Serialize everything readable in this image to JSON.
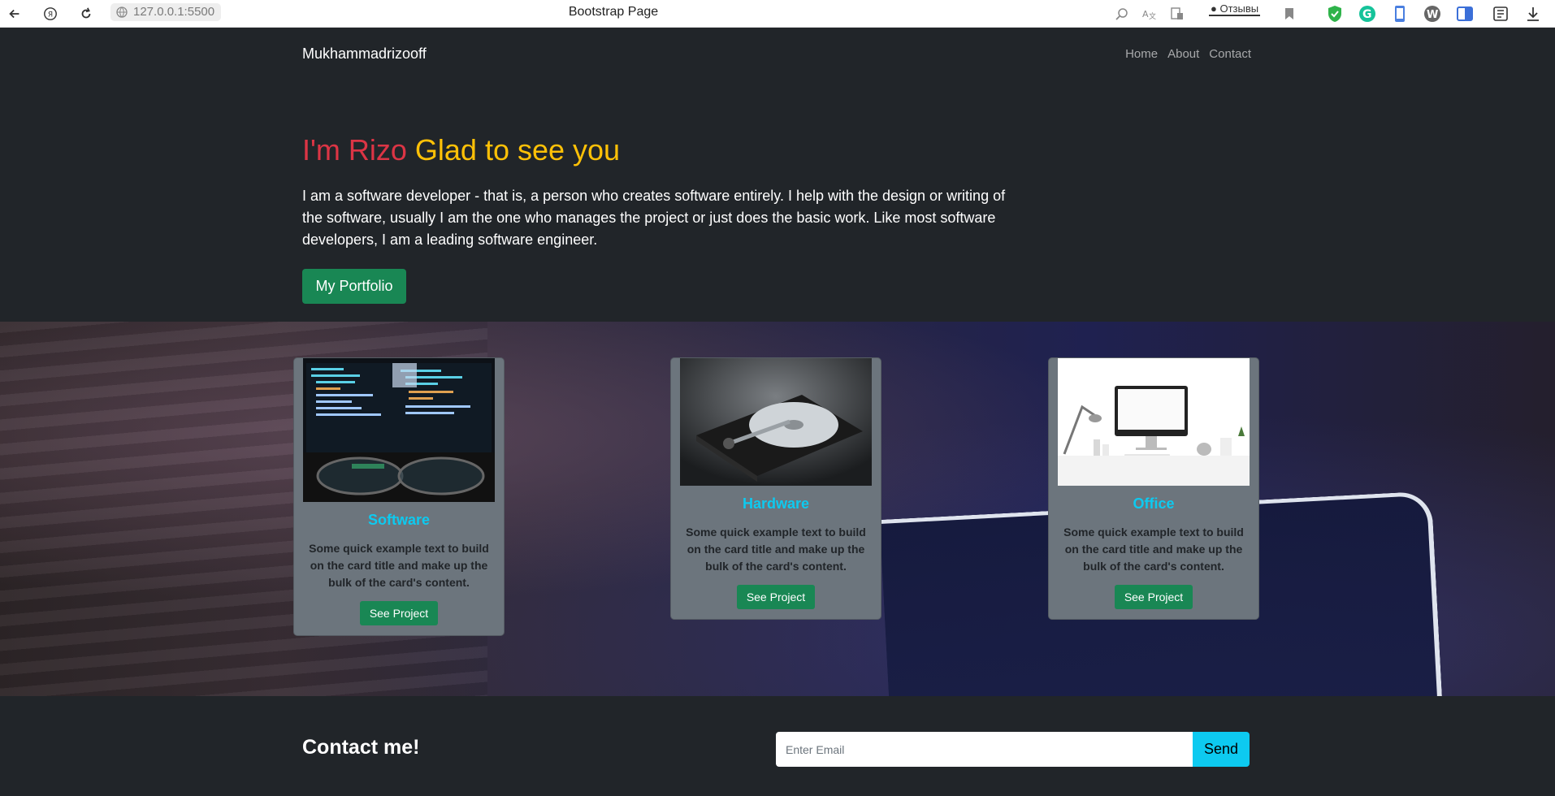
{
  "browser": {
    "url": "127.0.0.1:5500",
    "tab_title": "Bootstrap Page",
    "feedback_label": "Отзывы"
  },
  "nav": {
    "brand": "Mukhammadrizooff",
    "links": [
      "Home",
      "About",
      "Contact"
    ]
  },
  "hero": {
    "title_red": "I'm Rizo",
    "title_yellow": "Glad to see you",
    "text": "I am a software developer - that is, a person who creates software entirely. I help with the design or writing of the software, usually I am the one who manages the project or just does the basic work. Like most software developers, I am a leading software engineer.",
    "button": "My Portfolio"
  },
  "cards": [
    {
      "title": "Software",
      "text": "Some quick example text to build on the card title and make up the bulk of the card's content.",
      "button": "See Project",
      "image": "code-screen-glasses-photo"
    },
    {
      "title": "Hardware",
      "text": "Some quick example text to build on the card title and make up the bulk of the card's content.",
      "button": "See Project",
      "image": "hard-drive-photo"
    },
    {
      "title": "Office",
      "text": "Some quick example text to build on the card title and make up the bulk of the card's content.",
      "button": "See Project",
      "image": "desk-monitor-photo"
    }
  ],
  "contact": {
    "title": "Contact me!",
    "email_placeholder": "Enter Email",
    "send_label": "Send"
  },
  "colors": {
    "bg_dark": "#212529",
    "red": "#dc3545",
    "yellow": "#ffc107",
    "green": "#198754",
    "cyan": "#0dcaf0",
    "card_bg": "#6c757d"
  }
}
